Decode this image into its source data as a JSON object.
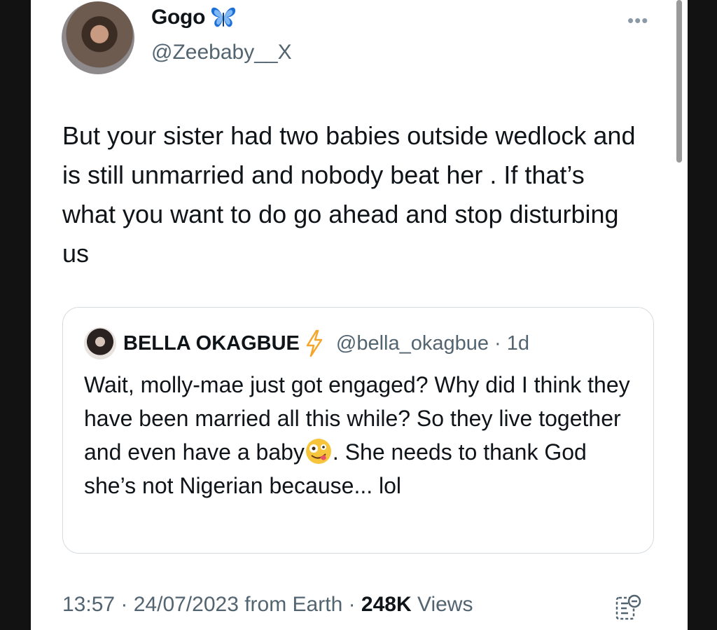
{
  "author": {
    "name": "Gogo",
    "name_emoji_icon": "blue-butterfly-icon",
    "handle": "@Zeebaby__X"
  },
  "more_icon": "more-horizontal-icon",
  "tweet": {
    "text": "But your sister had two babies outside wedlock and is still unmarried and nobody beat her . If that’s what you want to do go ahead and stop disturbing us"
  },
  "quoted_tweet": {
    "name": "BELLA OKAGBUE",
    "name_emoji_icon": "lightning-bolt-icon",
    "handle_time": "@bella_okagbue · 1d",
    "text_before_emoji": "Wait, molly-mae just got engaged? Why did I think they have been married all this while? So they live together and even have a baby",
    "emoji_icon": "zany-face-icon",
    "text_after_emoji": ". She needs to thank God she’s not Nigerian because... lol"
  },
  "meta": {
    "timestamp": "13:57 · 24/07/2023 from Earth · ",
    "views_count": "248K",
    "views_label": " Views"
  },
  "analytics_icon": "analytics-icon",
  "colors": {
    "text_primary": "#0f1419",
    "text_secondary": "#536471",
    "border": "#d6dbe0",
    "background": "#ffffff",
    "frame": "#121212"
  }
}
